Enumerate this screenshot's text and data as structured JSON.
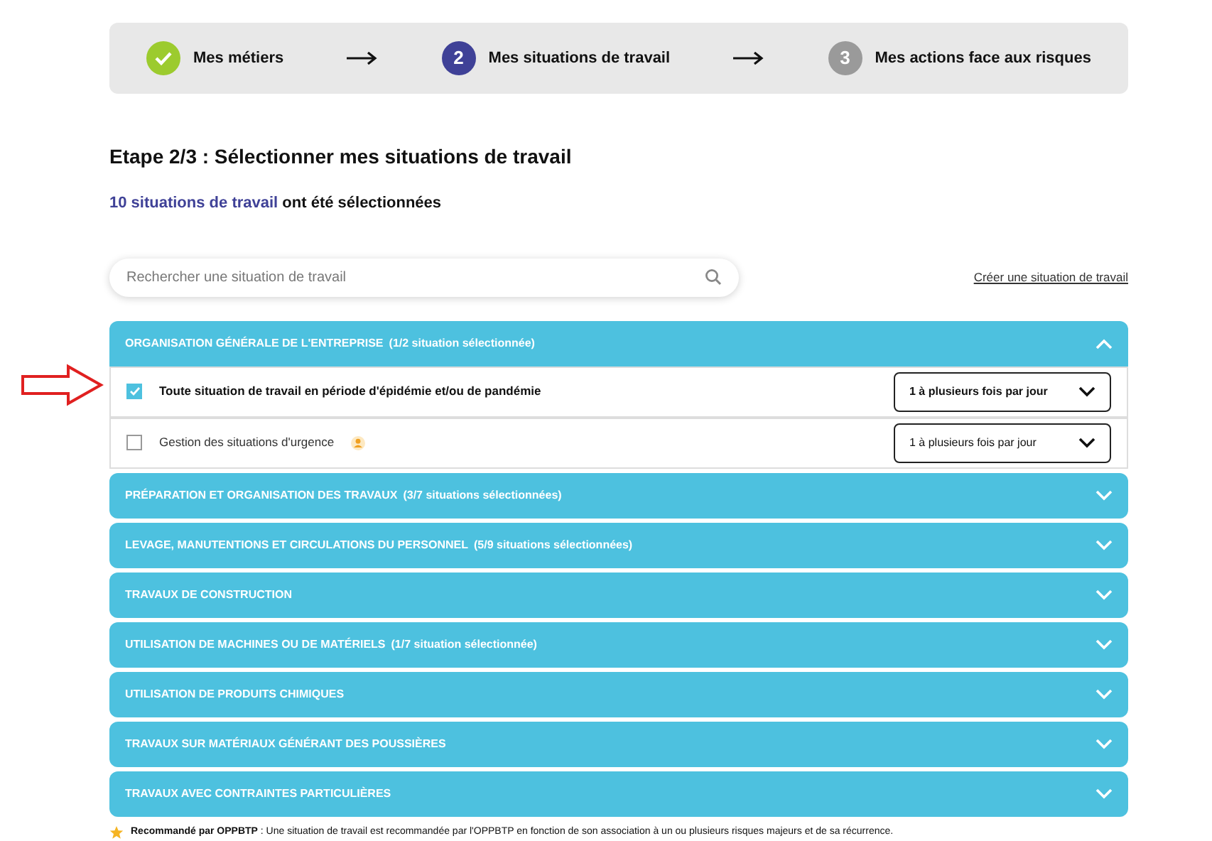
{
  "steps": [
    {
      "kind": "done",
      "label": "Mes métiers"
    },
    {
      "kind": "current",
      "number": "2",
      "label": "Mes situations de travail"
    },
    {
      "kind": "todo",
      "number": "3",
      "label": "Mes actions face aux risques"
    }
  ],
  "heading": "Etape 2/3 : Sélectionner mes situations de travail",
  "summary": {
    "count": "10 situations de travail",
    "rest": " ont été sélectionnées"
  },
  "search": {
    "placeholder": "Rechercher une situation de travail"
  },
  "create_link": "Créer une situation de travail",
  "categories": [
    {
      "title": "ORGANISATION GÉNÉRALE DE L'ENTREPRISE",
      "count": "(1/2 situation sélectionnée)",
      "expanded": true,
      "items": [
        {
          "label": "Toute situation de travail en période d'épidémie et/ou de pandémie",
          "checked": true,
          "recommended": false,
          "frequency": "1 à plusieurs fois par jour"
        },
        {
          "label": "Gestion des situations d'urgence",
          "checked": false,
          "recommended": true,
          "frequency": "1 à plusieurs fois par jour"
        }
      ]
    },
    {
      "title": "PRÉPARATION ET ORGANISATION DES TRAVAUX",
      "count": "(3/7 situations sélectionnées)",
      "expanded": false
    },
    {
      "title": "LEVAGE, MANUTENTIONS ET CIRCULATIONS DU PERSONNEL",
      "count": "(5/9 situations sélectionnées)",
      "expanded": false
    },
    {
      "title": "TRAVAUX DE CONSTRUCTION",
      "expanded": false
    },
    {
      "title": "UTILISATION DE MACHINES OU DE MATÉRIELS",
      "count": "(1/7 situation sélectionnée)",
      "expanded": false
    },
    {
      "title": "UTILISATION DE PRODUITS CHIMIQUES",
      "expanded": false
    },
    {
      "title": "TRAVAUX SUR MATÉRIAUX GÉNÉRANT DES POUSSIÈRES",
      "expanded": false
    },
    {
      "title": "TRAVAUX AVEC CONTRAINTES PARTICULIÈRES",
      "expanded": false
    }
  ],
  "footnote": "**Recommandé par OPPBTP** : Une situation de travail est recommandée par l'OPPBTP en fonction de son association à un ou plusieurs risques majeurs et de sa récurrence."
}
